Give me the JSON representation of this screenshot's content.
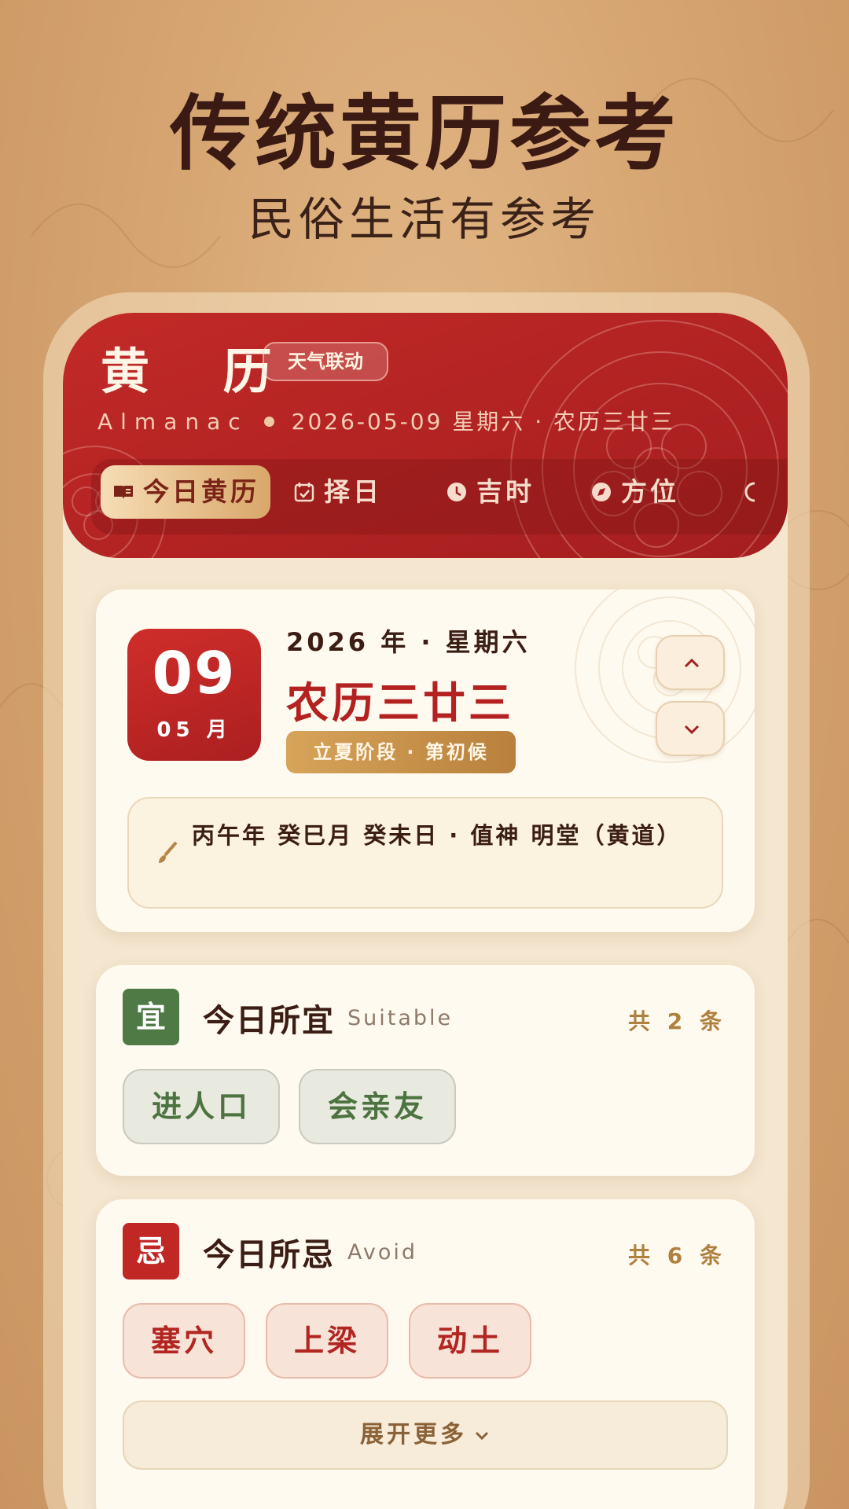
{
  "hero": {
    "title": "传统黄历参考",
    "subtitle": "民俗生活有参考"
  },
  "header": {
    "app_title": "黄 历",
    "weather_badge": "天气联动",
    "en_label": "Almanac",
    "date_line": "2026-05-09 星期六 · 农历三廿三",
    "tabs": [
      {
        "label": "今日黄历",
        "icon": "book-icon",
        "active": true
      },
      {
        "label": "择日",
        "icon": "calendar-check-icon",
        "active": false
      },
      {
        "label": "吉时",
        "icon": "clock-icon",
        "active": false
      },
      {
        "label": "方位",
        "icon": "compass-icon",
        "active": false
      }
    ]
  },
  "date_card": {
    "day": "09",
    "month": "05 月",
    "year_weekday": "2026 年 · 星期六",
    "lunar": "农历三廿三",
    "solar_term": "立夏阶段 · 第初候",
    "ganzhi": "丙午年 癸巳月 癸未日 · 值神 明堂（黄道）"
  },
  "suitable": {
    "icon_char": "宜",
    "title": "今日所宜",
    "en": "Suitable",
    "count": "共 2 条",
    "items": [
      "进人口",
      "会亲友"
    ]
  },
  "avoid": {
    "icon_char": "忌",
    "title": "今日所忌",
    "en": "Avoid",
    "count": "共 6 条",
    "items": [
      "塞穴",
      "上梁",
      "动土"
    ],
    "expand_label": "展开更多"
  },
  "colors": {
    "primary_red": "#b32221",
    "gold": "#c8954c",
    "green": "#4f7a45",
    "paper": "#fffaf0"
  }
}
